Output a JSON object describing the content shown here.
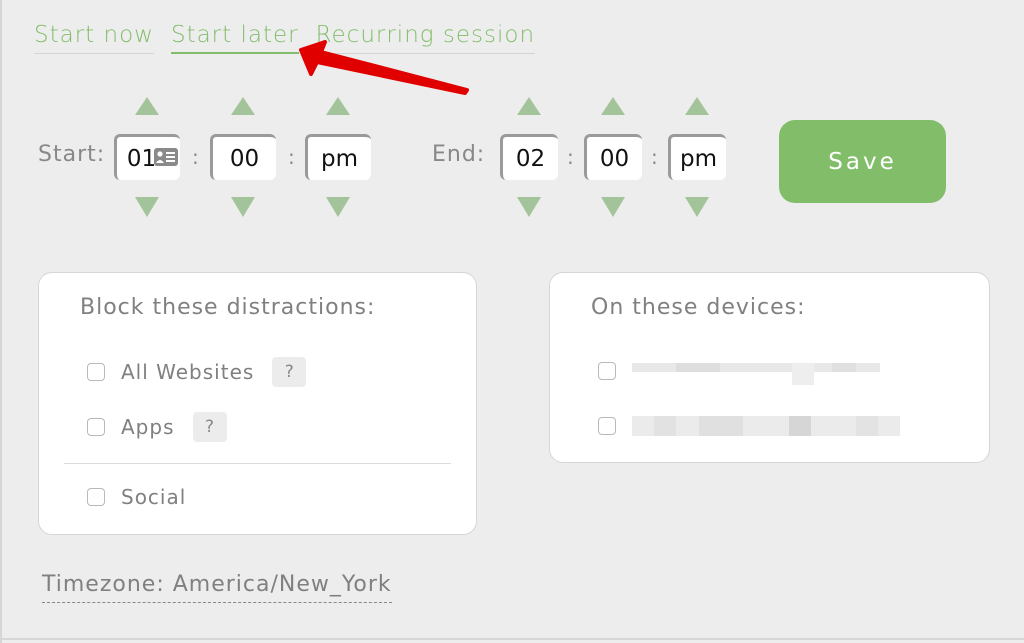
{
  "tabs": [
    {
      "label": "Start now",
      "active": false
    },
    {
      "label": "Start later",
      "active": true
    },
    {
      "label": "Recurring session",
      "active": false
    }
  ],
  "start": {
    "label": "Start:",
    "hour": "01",
    "minute": "00",
    "ampm": "pm",
    "separator": ":"
  },
  "end": {
    "label": "End:",
    "hour": "02",
    "minute": "00",
    "ampm": "pm",
    "separator": ":"
  },
  "save_label": "Save",
  "distractions": {
    "title": "Block these distractions:",
    "options": [
      {
        "label": "All Websites",
        "help": "?",
        "checked": false
      },
      {
        "label": "Apps",
        "help": "?",
        "checked": false
      },
      {
        "label": "Social",
        "checked": false
      }
    ]
  },
  "devices": {
    "title": "On these devices:",
    "items": [
      {
        "label": "[redacted]",
        "checked": false
      },
      {
        "label": "[redacted]",
        "checked": false
      }
    ]
  },
  "timezone": "Timezone: America/New_York",
  "colors": {
    "accent": "#82bd6a",
    "spinner": "#a3c49a",
    "annotation_arrow": "#e00000"
  },
  "icons": {
    "spin_up": "triangle-up-icon",
    "spin_down": "triangle-down-icon",
    "autofill": "contact-card-icon",
    "help": "question-mark-icon"
  }
}
